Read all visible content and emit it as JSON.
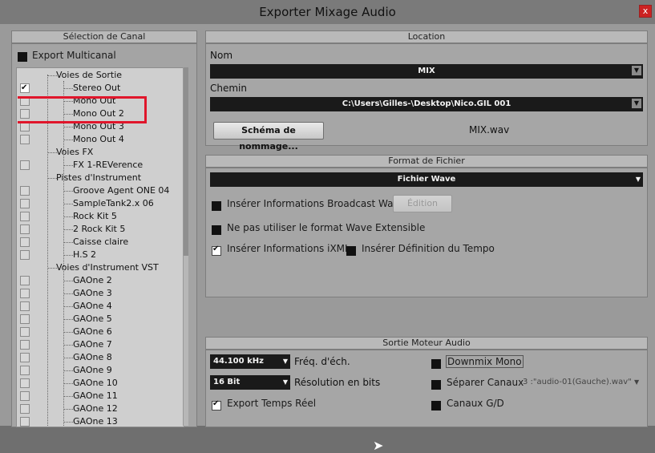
{
  "window": {
    "title": "Exporter Mixage Audio",
    "close_label": "x"
  },
  "channel_selection": {
    "header": "Sélection de Canal",
    "export_multicanal": "Export Multicanal",
    "tree": [
      {
        "label": "Voies de Sortie",
        "level": 0,
        "checkbox": false
      },
      {
        "label": "Stereo Out",
        "level": 1,
        "checkbox": true,
        "checked": true
      },
      {
        "label": "Mono Out",
        "level": 1,
        "checkbox": true,
        "checked": false
      },
      {
        "label": "Mono Out 2",
        "level": 1,
        "checkbox": true,
        "checked": false
      },
      {
        "label": "Mono Out 3",
        "level": 1,
        "checkbox": true,
        "checked": false
      },
      {
        "label": "Mono Out 4",
        "level": 1,
        "checkbox": true,
        "checked": false
      },
      {
        "label": "Voies FX",
        "level": 0,
        "checkbox": false
      },
      {
        "label": "FX 1-REVerence",
        "level": 1,
        "checkbox": true,
        "checked": false
      },
      {
        "label": "Pistes d'Instrument",
        "level": 0,
        "checkbox": false
      },
      {
        "label": "Groove Agent ONE 04",
        "level": 1,
        "checkbox": true,
        "checked": false
      },
      {
        "label": "SampleTank2.x 06",
        "level": 1,
        "checkbox": true,
        "checked": false
      },
      {
        "label": "Rock Kit 5",
        "level": 1,
        "checkbox": true,
        "checked": false
      },
      {
        "label": "2 Rock Kit 5",
        "level": 1,
        "checkbox": true,
        "checked": false
      },
      {
        "label": "Caisse claire",
        "level": 1,
        "checkbox": true,
        "checked": false
      },
      {
        "label": "H.S 2",
        "level": 1,
        "checkbox": true,
        "checked": false
      },
      {
        "label": "Voies d'Instrument VST",
        "level": 0,
        "checkbox": false
      },
      {
        "label": "GAOne 2",
        "level": 1,
        "checkbox": true,
        "checked": false
      },
      {
        "label": "GAOne 3",
        "level": 1,
        "checkbox": true,
        "checked": false
      },
      {
        "label": "GAOne 4",
        "level": 1,
        "checkbox": true,
        "checked": false
      },
      {
        "label": "GAOne 5",
        "level": 1,
        "checkbox": true,
        "checked": false
      },
      {
        "label": "GAOne 6",
        "level": 1,
        "checkbox": true,
        "checked": false
      },
      {
        "label": "GAOne 7",
        "level": 1,
        "checkbox": true,
        "checked": false
      },
      {
        "label": "GAOne 8",
        "level": 1,
        "checkbox": true,
        "checked": false
      },
      {
        "label": "GAOne 9",
        "level": 1,
        "checkbox": true,
        "checked": false
      },
      {
        "label": "GAOne 10",
        "level": 1,
        "checkbox": true,
        "checked": false
      },
      {
        "label": "GAOne 11",
        "level": 1,
        "checkbox": true,
        "checked": false
      },
      {
        "label": "GAOne 12",
        "level": 1,
        "checkbox": true,
        "checked": false
      },
      {
        "label": "GAOne 13",
        "level": 1,
        "checkbox": true,
        "checked": false
      }
    ]
  },
  "location": {
    "header": "Location",
    "name_label": "Nom",
    "name_value": "MIX",
    "path_label": "Chemin",
    "path_value": "C:\\Users\\Gilles-\\Desktop\\Nico.GIL 001",
    "naming_button": "Schéma de nommage...",
    "filename": "MIX.wav"
  },
  "file_format": {
    "header": "Format de Fichier",
    "format_value": "Fichier Wave",
    "broadcast_wave": "Insérer Informations Broadcast Wave",
    "edit_button": "Édition",
    "no_wave_extensible": "Ne pas utiliser le format Wave Extensible",
    "ixml": "Insérer Informations iXML",
    "tempo": "Insérer Définition du Tempo"
  },
  "engine_output": {
    "header": "Sortie Moteur Audio",
    "sample_rate_value": "44.100 kHz",
    "sample_rate_label": "Fréq. d'éch.",
    "bit_depth_value": "16 Bit",
    "bit_depth_label": "Résolution en bits",
    "realtime_export": "Export Temps Réel",
    "downmix_mono": "Downmix Mono",
    "split_channels": "Séparer Canaux",
    "split_channels_value": "3 :\"audio-01(Gauche).wav\"",
    "lr_channels": "Canaux G/D"
  }
}
